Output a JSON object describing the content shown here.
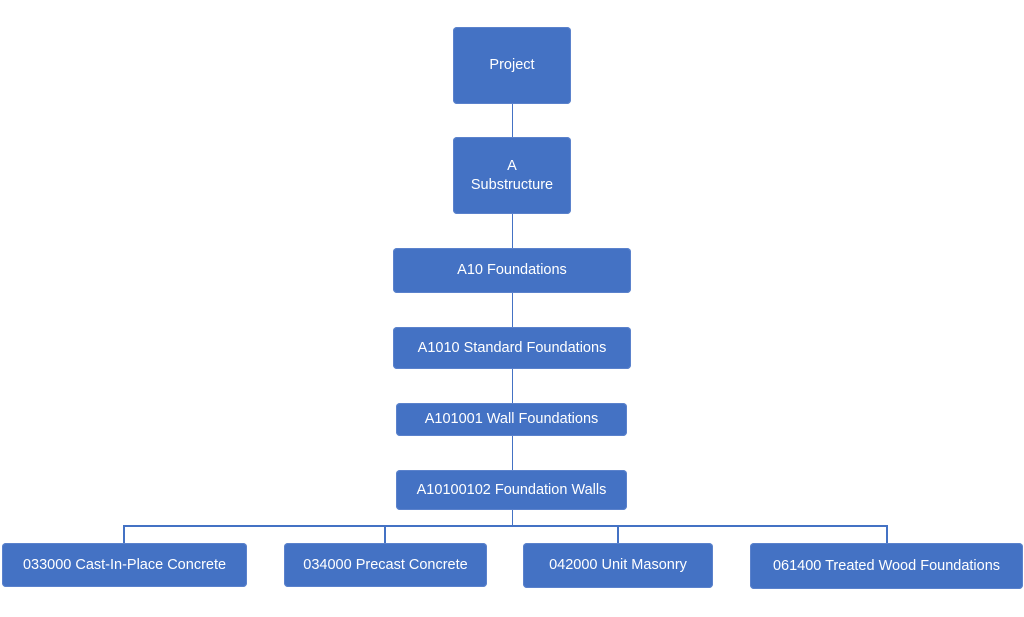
{
  "diagram": {
    "type": "hierarchy",
    "colors": {
      "node_fill": "#4472c4",
      "node_text": "#ffffff",
      "connector": "#4472c4"
    },
    "nodes": [
      {
        "id": "project",
        "label_line1": "Project",
        "label_line2": ""
      },
      {
        "id": "a",
        "label_line1": "A",
        "label_line2": "Substructure"
      },
      {
        "id": "a10",
        "label_line1": "A10 Foundations",
        "label_line2": ""
      },
      {
        "id": "a1010",
        "label_line1": "A1010 Standard Foundations",
        "label_line2": ""
      },
      {
        "id": "a101001",
        "label_line1": "A101001 Wall Foundations",
        "label_line2": ""
      },
      {
        "id": "a10100102",
        "label_line1": "A10100102 Foundation Walls",
        "label_line2": ""
      },
      {
        "id": "033000",
        "label_line1": "033000 Cast-In-Place Concrete",
        "label_line2": ""
      },
      {
        "id": "034000",
        "label_line1": "034000 Precast Concrete",
        "label_line2": ""
      },
      {
        "id": "042000",
        "label_line1": "042000 Unit Masonry",
        "label_line2": ""
      },
      {
        "id": "061400",
        "label_line1": "061400 Treated Wood Foundations",
        "label_line2": ""
      }
    ],
    "edges": [
      [
        "project",
        "a"
      ],
      [
        "a",
        "a10"
      ],
      [
        "a10",
        "a1010"
      ],
      [
        "a1010",
        "a101001"
      ],
      [
        "a101001",
        "a10100102"
      ],
      [
        "a10100102",
        "033000"
      ],
      [
        "a10100102",
        "034000"
      ],
      [
        "a10100102",
        "042000"
      ],
      [
        "a10100102",
        "061400"
      ]
    ]
  }
}
